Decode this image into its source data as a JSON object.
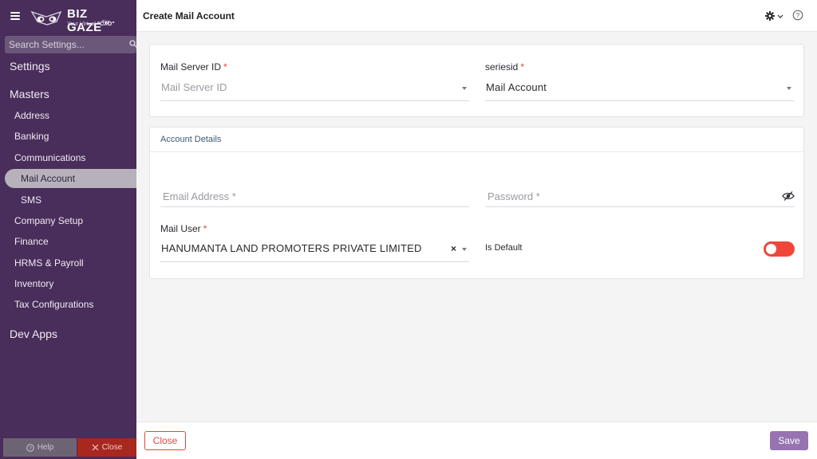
{
  "brand": {
    "name": "BIZ GAZE",
    "trademark": "TM",
    "tagline_prefix": "Your Virtual",
    "tagline_highlight": "\"CXO\""
  },
  "sidebar": {
    "search_placeholder": "Search Settings...",
    "settings_heading": "Settings",
    "masters_heading": "Masters",
    "items": [
      {
        "label": "Address"
      },
      {
        "label": "Banking"
      },
      {
        "label": "Communications"
      },
      {
        "label": "Mail Account",
        "active": true
      },
      {
        "label": "SMS"
      },
      {
        "label": "Company Setup"
      },
      {
        "label": "Finance"
      },
      {
        "label": "HRMS & Payroll"
      },
      {
        "label": "Inventory"
      },
      {
        "label": "Tax Configurations"
      }
    ],
    "dev_apps_heading": "Dev Apps",
    "help_label": "Help",
    "close_label": "Close"
  },
  "header": {
    "title": "Create Mail Account",
    "settings_icon": "gear-icon",
    "help_icon": "question-circle-icon"
  },
  "form": {
    "mail_server_id": {
      "label": "Mail Server ID",
      "required_mark": "*",
      "placeholder": "Mail Server ID"
    },
    "seriesid": {
      "label": "seriesid",
      "required_mark": "*",
      "value": "Mail Account"
    },
    "account_details": {
      "title": "Account Details",
      "email_placeholder": "Email Address *",
      "password_placeholder": "Password *",
      "mail_user": {
        "label": "Mail User",
        "required_mark": "*",
        "value": "HANUMANTA LAND PROMOTERS PRIVATE LIMITED"
      },
      "is_default": {
        "label": "Is Default",
        "enabled": false
      }
    }
  },
  "footer": {
    "close_label": "Close",
    "save_label": "Save"
  },
  "colors": {
    "sidebar_bg": "#492d5a",
    "accent_purple": "#9773b2",
    "danger_red": "#e8453c"
  }
}
